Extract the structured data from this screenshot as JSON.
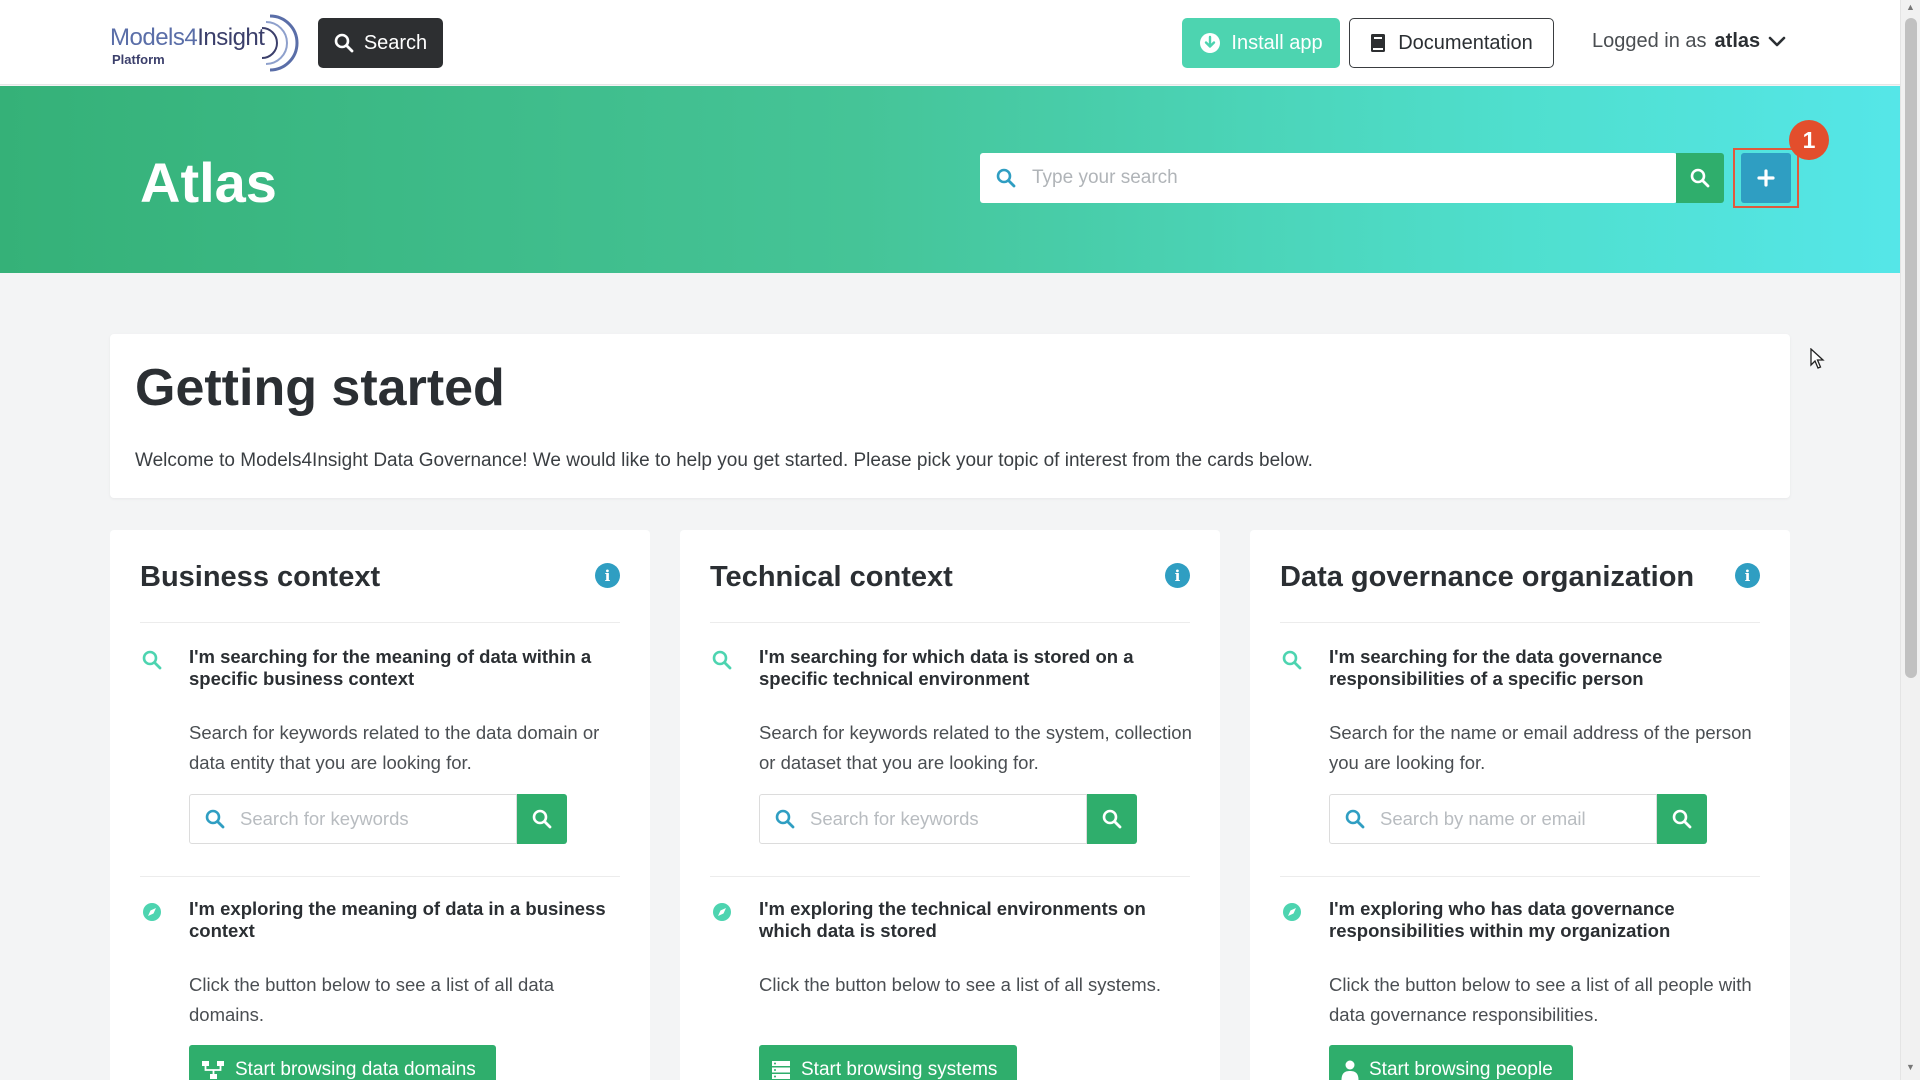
{
  "navbar": {
    "logo": {
      "brand_light": "Models4",
      "brand_dark": "Insight",
      "subtitle": "Platform"
    },
    "search_label": "Search",
    "install_label": "Install app",
    "documentation_label": "Documentation",
    "user_prefix": "Logged in as",
    "username": "atlas"
  },
  "hero": {
    "title": "Atlas",
    "search_placeholder": "Type your search",
    "add_badge": "1"
  },
  "getting_started": {
    "title": "Getting started",
    "text": "Welcome to Models4Insight Data Governance! We would like to help you get started. Please pick your topic of interest from the cards below."
  },
  "cards": [
    {
      "title": "Business context",
      "search_heading": "I'm searching for the meaning of data within a specific business context",
      "search_text": "Search for keywords related to the data domain or data entity that you are looking for.",
      "search_placeholder": "Search for keywords",
      "explore_heading": "I'm exploring the meaning of data in a business context",
      "explore_text": "Click the button below to see a list of all data domains.",
      "browse_label": "Start browsing data domains",
      "browse_icon": "sitemap-icon"
    },
    {
      "title": "Technical context",
      "search_heading": "I'm searching for which data is stored on a specific technical environment",
      "search_text": "Search for keywords related to the system, collection or dataset that you are looking for.",
      "search_placeholder": "Search for keywords",
      "explore_heading": "I'm exploring the technical environments on which data is stored",
      "explore_text": "Click the button below to see a list of all systems.",
      "browse_label": "Start browsing systems",
      "browse_icon": "server-icon"
    },
    {
      "title": "Data governance organization",
      "search_heading": "I'm searching for the data governance responsibilities of a specific person",
      "search_text": "Search for the name or email address of the person you are looking for.",
      "search_placeholder": "Search by name or email",
      "explore_heading": "I'm exploring who has data governance responsibilities within my organization",
      "explore_text": "Click the button below to see a list of all people with data governance responsibilities.",
      "browse_label": "Start browsing people",
      "browse_icon": "user-icon"
    }
  ],
  "colors": {
    "green": "#2fae6c",
    "teal": "#4dd4b0",
    "blue": "#2f9ec2",
    "badge_red": "#e34e2c"
  }
}
